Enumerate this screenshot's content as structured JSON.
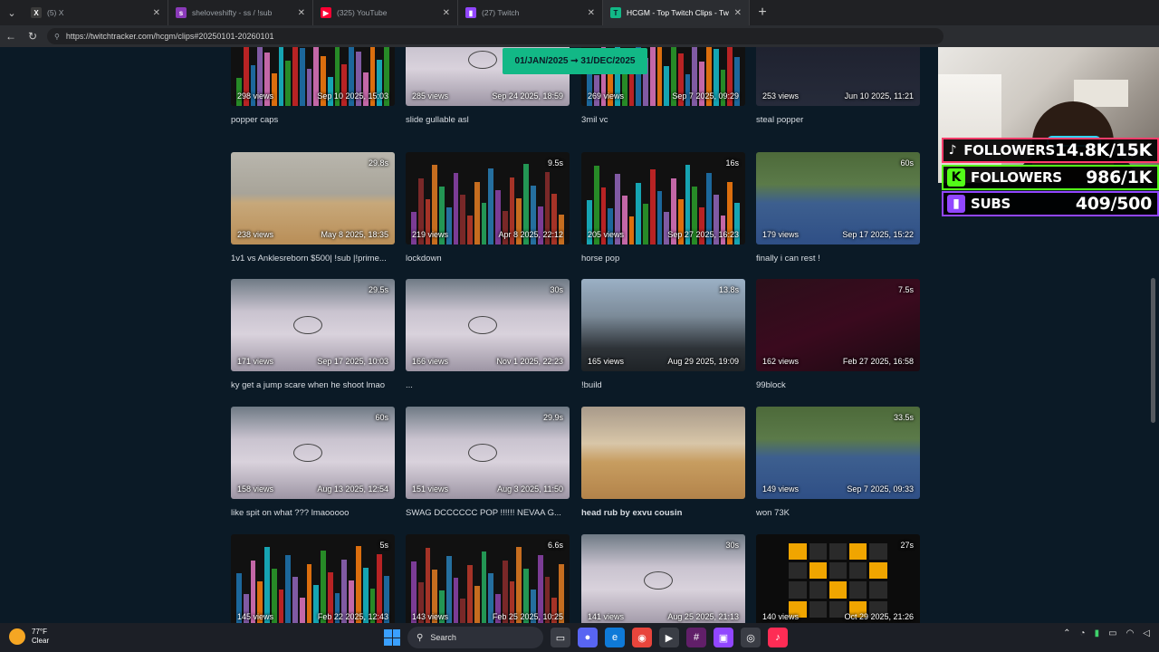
{
  "browser": {
    "tabs": [
      {
        "title": "(5) X",
        "icon": "x-icon",
        "color": "#2a2a2a"
      },
      {
        "title": "sheloveshifty - ss / !sub",
        "icon": "site-icon",
        "color": "#8a3ab9"
      },
      {
        "title": "(325) YouTube",
        "icon": "youtube-icon",
        "color": "#ff0033"
      },
      {
        "title": "(27) Twitch",
        "icon": "twitch-icon",
        "color": "#9146ff"
      },
      {
        "title": "HCGM - Top Twitch Clips - TwitchTracker",
        "icon": "twitchtracker-icon",
        "color": "#12b886",
        "active": true
      }
    ],
    "url": "https://twitchtracker.com/hcgm/clips#20250101-20260101"
  },
  "date_range": "01/JAN/2025 ➞ 31/DEC/2025",
  "clips": [
    {
      "views": "298 views",
      "date": "Sep 10 2025, 15:03",
      "duration": "",
      "title": "popper caps",
      "thumb": "bars"
    },
    {
      "views": "285 views",
      "date": "Sep 24 2025, 18:59",
      "duration": "",
      "title": "slide gullable asl",
      "thumb": "game"
    },
    {
      "views": "269 views",
      "date": "Sep 7 2025, 09:29",
      "duration": "",
      "title": "3mil vc",
      "thumb": "bars"
    },
    {
      "views": "253 views",
      "date": "Jun 10 2025, 11:21",
      "duration": "",
      "title": "steal popper",
      "thumb": "stats"
    },
    {
      "views": "238 views",
      "date": "May 8 2025, 18:35",
      "duration": "29.8s",
      "title": "1v1 vs Anklesreborn $500| !sub |!prime...",
      "thumb": "gym"
    },
    {
      "views": "219 views",
      "date": "Apr 8 2025, 22:12",
      "duration": "9.5s",
      "title": "lockdown",
      "thumb": "bars"
    },
    {
      "views": "205 views",
      "date": "Sep 27 2025, 16:23",
      "duration": "16s",
      "title": "horse pop",
      "thumb": "bars"
    },
    {
      "views": "179 views",
      "date": "Sep 17 2025, 15:22",
      "duration": "60s",
      "title": "finally i can rest !",
      "thumb": "outdoor"
    },
    {
      "views": "171 views",
      "date": "Sep 17 2025, 10:03",
      "duration": "29.5s",
      "title": "ky get a jump scare when he shoot lmao",
      "thumb": "game"
    },
    {
      "views": "166 views",
      "date": "Nov 1 2025, 22:23",
      "duration": "30s",
      "title": "...",
      "thumb": "game"
    },
    {
      "views": "165 views",
      "date": "Aug 29 2025, 19:09",
      "duration": "13.8s",
      "title": "!build",
      "thumb": "city"
    },
    {
      "views": "162 views",
      "date": "Feb 27 2025, 16:58",
      "duration": "7.5s",
      "title": "99block",
      "thumb": "dark"
    },
    {
      "views": "158 views",
      "date": "Aug 13 2025, 12:54",
      "duration": "60s",
      "title": "like spit on what ??? lmaooooo",
      "thumb": "game"
    },
    {
      "views": "151 views",
      "date": "Aug 3 2025, 11:50",
      "duration": "29.9s",
      "title": "SWAG DCCCCCC POP !!!!!! NEVAA G...",
      "thumb": "game"
    },
    {
      "views": "",
      "date": "",
      "duration": "",
      "title": "head rub by exvu cousin",
      "thumb": "wood",
      "bold": true
    },
    {
      "views": "149 views",
      "date": "Sep 7 2025, 09:33",
      "duration": "33.5s",
      "title": "won 73K",
      "thumb": "outdoor"
    },
    {
      "views": "145 views",
      "date": "Feb 22 2025, 12:43",
      "duration": "5s",
      "title": "",
      "thumb": "bars"
    },
    {
      "views": "143 views",
      "date": "Feb 25 2025, 10:25",
      "duration": "6.6s",
      "title": "",
      "thumb": "bars"
    },
    {
      "views": "141 views",
      "date": "Aug 25 2025, 21:13",
      "duration": "30s",
      "title": "",
      "thumb": "game"
    },
    {
      "views": "140 views",
      "date": "Oct 29 2025, 21:26",
      "duration": "27s",
      "title": "",
      "thumb": "grid"
    }
  ],
  "overlay": {
    "goals": [
      {
        "label": "FOLLOWERS",
        "value": "14.8K/15K",
        "platform": "tiktok",
        "icon": "tiktok-icon",
        "color": "#ff3c6a"
      },
      {
        "label": "FOLLOWERS",
        "value": "986/1K",
        "platform": "kick",
        "icon": "kick-icon",
        "color": "#53fc18"
      },
      {
        "label": "SUBS",
        "value": "409/500",
        "platform": "twitch",
        "icon": "twitch-icon",
        "color": "#9146ff"
      }
    ]
  },
  "taskbar": {
    "weather_temp": "77°F",
    "weather_desc": "Clear",
    "search_placeholder": "Search"
  }
}
